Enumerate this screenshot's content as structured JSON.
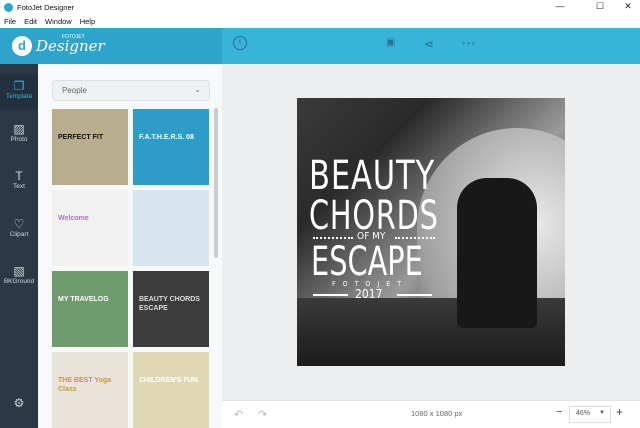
{
  "window": {
    "title": "FotoJet Designer",
    "controls": [
      "—",
      "☐",
      "✕"
    ]
  },
  "menu": [
    "File",
    "Edit",
    "Window",
    "Help"
  ],
  "brand": {
    "name": "Designer",
    "sub": "FOTOJET",
    "mark": "d"
  },
  "toolbar": {
    "back": "‹",
    "save": "💾",
    "share": "share",
    "more": "∘∘∘"
  },
  "sidebar": {
    "items": [
      {
        "label": "Template",
        "icon": "❐"
      },
      {
        "label": "Photo",
        "icon": "▨"
      },
      {
        "label": "Text",
        "icon": "T"
      },
      {
        "label": "Clipart",
        "icon": "♡"
      },
      {
        "label": "BKGround",
        "icon": "▧"
      }
    ],
    "settings": "⚙"
  },
  "panel": {
    "category": "People",
    "chevron": "⌄",
    "thumbnails": [
      {
        "text": "PERFECT FIT",
        "bg": "#b8ad8e",
        "fg": "#111"
      },
      {
        "text": "F.A.T.H.E.R.S. 08",
        "bg": "#2e9cc8",
        "fg": "#fff"
      },
      {
        "text": "Welcome",
        "bg": "#f1f1f1",
        "fg": "#a07bc2"
      },
      {
        "text": "",
        "bg": "#d7e6ee",
        "fg": "#fff"
      },
      {
        "text": "MY TRAVELOG",
        "bg": "#6f9b6e",
        "fg": "#fff"
      },
      {
        "text": "BEAUTY CHORDS ESCAPE",
        "bg": "#3c3c3c",
        "fg": "#ddd"
      },
      {
        "text": "THE BEST Yoga Class",
        "bg": "#e9e3d9",
        "fg": "#c79a3b"
      },
      {
        "text": "CHILDREN'S FUN",
        "bg": "#e0d8b5",
        "fg": "#fff"
      }
    ]
  },
  "design": {
    "line1": "BEAUTY",
    "line2": "CHORDS",
    "line3": "OF MY",
    "line4": "ESCAPE",
    "line5": "FOTOJET",
    "year": "2017"
  },
  "bottom": {
    "undo": "↶",
    "redo": "↷",
    "size": "1080 x 1080 px",
    "zoom_out": "−",
    "zoom": "46%",
    "zoom_in": "+"
  }
}
